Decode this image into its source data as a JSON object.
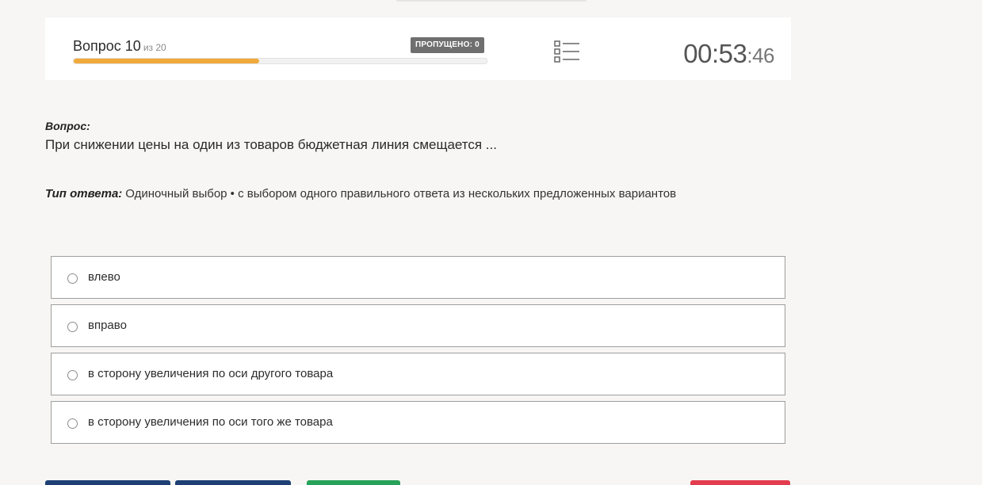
{
  "header": {
    "question_label": "Вопрос 10",
    "question_of": "из 20",
    "skipped": "ПРОПУЩЕНО: 0",
    "progress_fraction": 0.45,
    "timer_main": "00:53",
    "timer_seconds": ":46",
    "list_icon": "question-list-icon"
  },
  "question": {
    "label": "Вопрос:",
    "text": "При снижении цены на один из товаров бюджетная линия смещается ..."
  },
  "answer_type": {
    "label": "Тип ответа:",
    "value": "Одиночный выбор • с выбором одного правильного ответа из нескольких предложенных вариантов"
  },
  "options": [
    {
      "label": "влево"
    },
    {
      "label": "вправо"
    },
    {
      "label": "в сторону увеличения по оси другого товара"
    },
    {
      "label": "в сторону увеличения по оси того же товара"
    }
  ],
  "colors": {
    "progress": "#f0a93a",
    "primary_button": "#1d3f73",
    "success_button": "#27a25a",
    "danger_button": "#e23d4e"
  }
}
